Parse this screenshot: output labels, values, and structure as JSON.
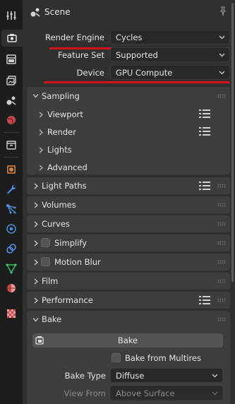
{
  "header": {
    "title": "Scene"
  },
  "render_engine": {
    "label": "Render Engine",
    "value": "Cycles"
  },
  "feature_set": {
    "label": "Feature Set",
    "value": "Supported"
  },
  "device": {
    "label": "Device",
    "value": "GPU Compute"
  },
  "sampling": {
    "title": "Sampling",
    "items": [
      "Viewport",
      "Render",
      "Lights",
      "Advanced"
    ]
  },
  "panels": {
    "light_paths": "Light Paths",
    "volumes": "Volumes",
    "curves": "Curves",
    "simplify": "Simplify",
    "motion_blur": "Motion Blur",
    "film": "Film",
    "performance": "Performance"
  },
  "bake": {
    "title": "Bake",
    "button": "Bake",
    "from_multires": "Bake from Multires",
    "bake_type_label": "Bake Type",
    "bake_type_value": "Diffuse",
    "view_from_label": "View From",
    "view_from_value": "Above Surface"
  },
  "colors": {
    "highlight": "#d5151d",
    "panel": "#3d3d3d",
    "background": "#303030"
  }
}
